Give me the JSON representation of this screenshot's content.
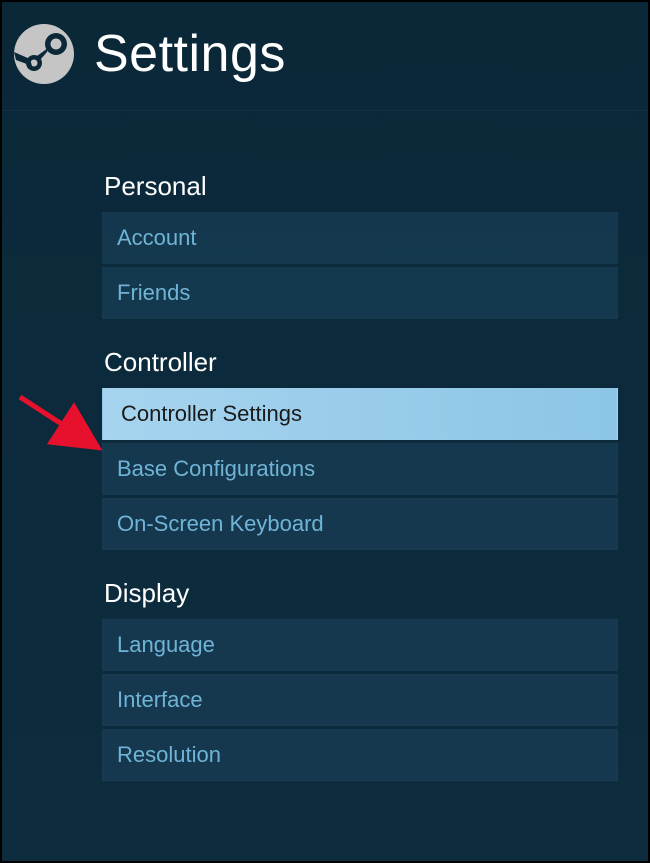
{
  "header": {
    "title": "Settings"
  },
  "sections": [
    {
      "header": "Personal",
      "items": [
        {
          "label": "Account",
          "selected": false
        },
        {
          "label": "Friends",
          "selected": false
        }
      ]
    },
    {
      "header": "Controller",
      "items": [
        {
          "label": "Controller Settings",
          "selected": true
        },
        {
          "label": "Base Configurations",
          "selected": false
        },
        {
          "label": "On-Screen Keyboard",
          "selected": false
        }
      ]
    },
    {
      "header": "Display",
      "items": [
        {
          "label": "Language",
          "selected": false
        },
        {
          "label": "Interface",
          "selected": false
        },
        {
          "label": "Resolution",
          "selected": false
        }
      ]
    }
  ]
}
